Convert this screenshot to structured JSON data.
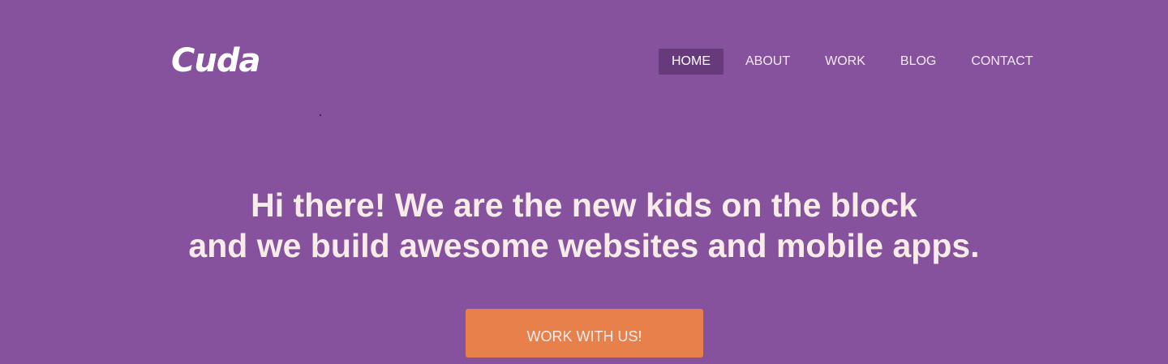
{
  "brand": {
    "logo_text": "Cuda"
  },
  "nav": {
    "items": [
      {
        "label": "HOME"
      },
      {
        "label": "ABOUT"
      },
      {
        "label": "WORK"
      },
      {
        "label": "BLOG"
      },
      {
        "label": "CONTACT"
      }
    ],
    "active": "HOME"
  },
  "hero": {
    "line1": "Hi there! We are the new kids on the block",
    "line2": "and we build awesome websites and mobile apps.",
    "cta_label": "WORK WITH US!"
  },
  "colors": {
    "background": "#86519d",
    "nav_active": "#673a7b",
    "cta": "#e8804c",
    "text_light": "#f7ece9"
  }
}
